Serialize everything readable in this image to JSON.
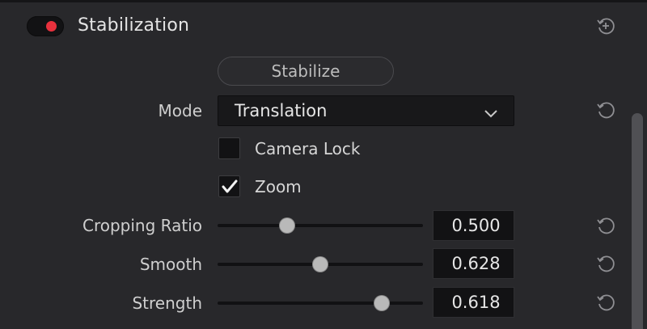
{
  "section": {
    "title": "Stabilization",
    "enabled": true,
    "toggle_color": "#e8313d"
  },
  "stabilize_button": {
    "label": "Stabilize"
  },
  "mode": {
    "label": "Mode",
    "selected": "Translation"
  },
  "options": [
    {
      "label": "Camera Lock",
      "checked": false
    },
    {
      "label": "Zoom",
      "checked": true
    }
  ],
  "sliders": [
    {
      "label": "Cropping Ratio",
      "value": "0.500",
      "position": 0.34
    },
    {
      "label": "Smooth",
      "value": "0.628",
      "position": 0.5
    },
    {
      "label": "Strength",
      "value": "0.618",
      "position": 0.8
    }
  ],
  "icons": {
    "reset": "reset-icon",
    "reset_all": "reset-all-icon",
    "dropdown": "chevron-down-icon",
    "check": "checkmark-icon"
  }
}
